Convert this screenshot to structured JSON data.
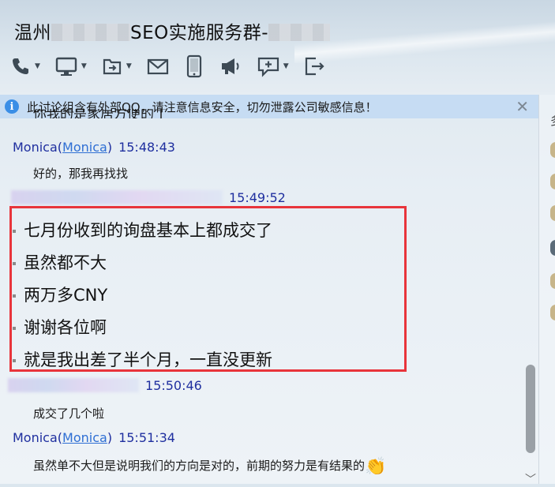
{
  "window": {
    "title_prefix": "温州",
    "title_mid": "SEO实施服务群-",
    "title_has_masks": true
  },
  "toolbar": {
    "items": [
      {
        "name": "phone-icon",
        "has_caret": true
      },
      {
        "name": "screen-share-icon",
        "has_caret": true
      },
      {
        "name": "transfer-file-icon",
        "has_caret": true
      },
      {
        "name": "mail-icon",
        "has_caret": false
      },
      {
        "name": "tablet-icon",
        "has_caret": false
      },
      {
        "name": "megaphone-icon",
        "has_caret": false
      },
      {
        "name": "add-app-icon",
        "has_caret": true
      },
      {
        "name": "exit-icon",
        "has_caret": false
      }
    ]
  },
  "notice": {
    "text": "此讨论组含有外部QQ，请注意信息安全，切勿泄露公司敏感信息！"
  },
  "chat": {
    "clipped_line": "你我的是家居方便的丁",
    "messages": [
      {
        "sender": "Monica",
        "sender_link": "Monica",
        "time": "15:48:43",
        "text": "好的，那我再找找"
      },
      {
        "sender_blurred": true,
        "time": "15:49:52",
        "lines": [
          "七月份收到的询盘基本上都成交了",
          "虽然都不大",
          "两万多CNY",
          "谢谢各位啊",
          "就是我出差了半个月，一直没更新"
        ]
      },
      {
        "sender_blurred": true,
        "time": "15:50:46",
        "text": "成交了几个啦"
      },
      {
        "sender": "Monica",
        "sender_link": "Monica",
        "time": "15:51:34",
        "text": "虽然单不大但是说明我们的方向是对的，前期的努力是有结果的",
        "emoji": "👏"
      }
    ]
  },
  "panel": {
    "header_char": "多"
  },
  "colors": {
    "highlight_border": "#e8343b",
    "sender_blue": "#1f2f9f",
    "notice_bg": "#c6dcf3"
  }
}
